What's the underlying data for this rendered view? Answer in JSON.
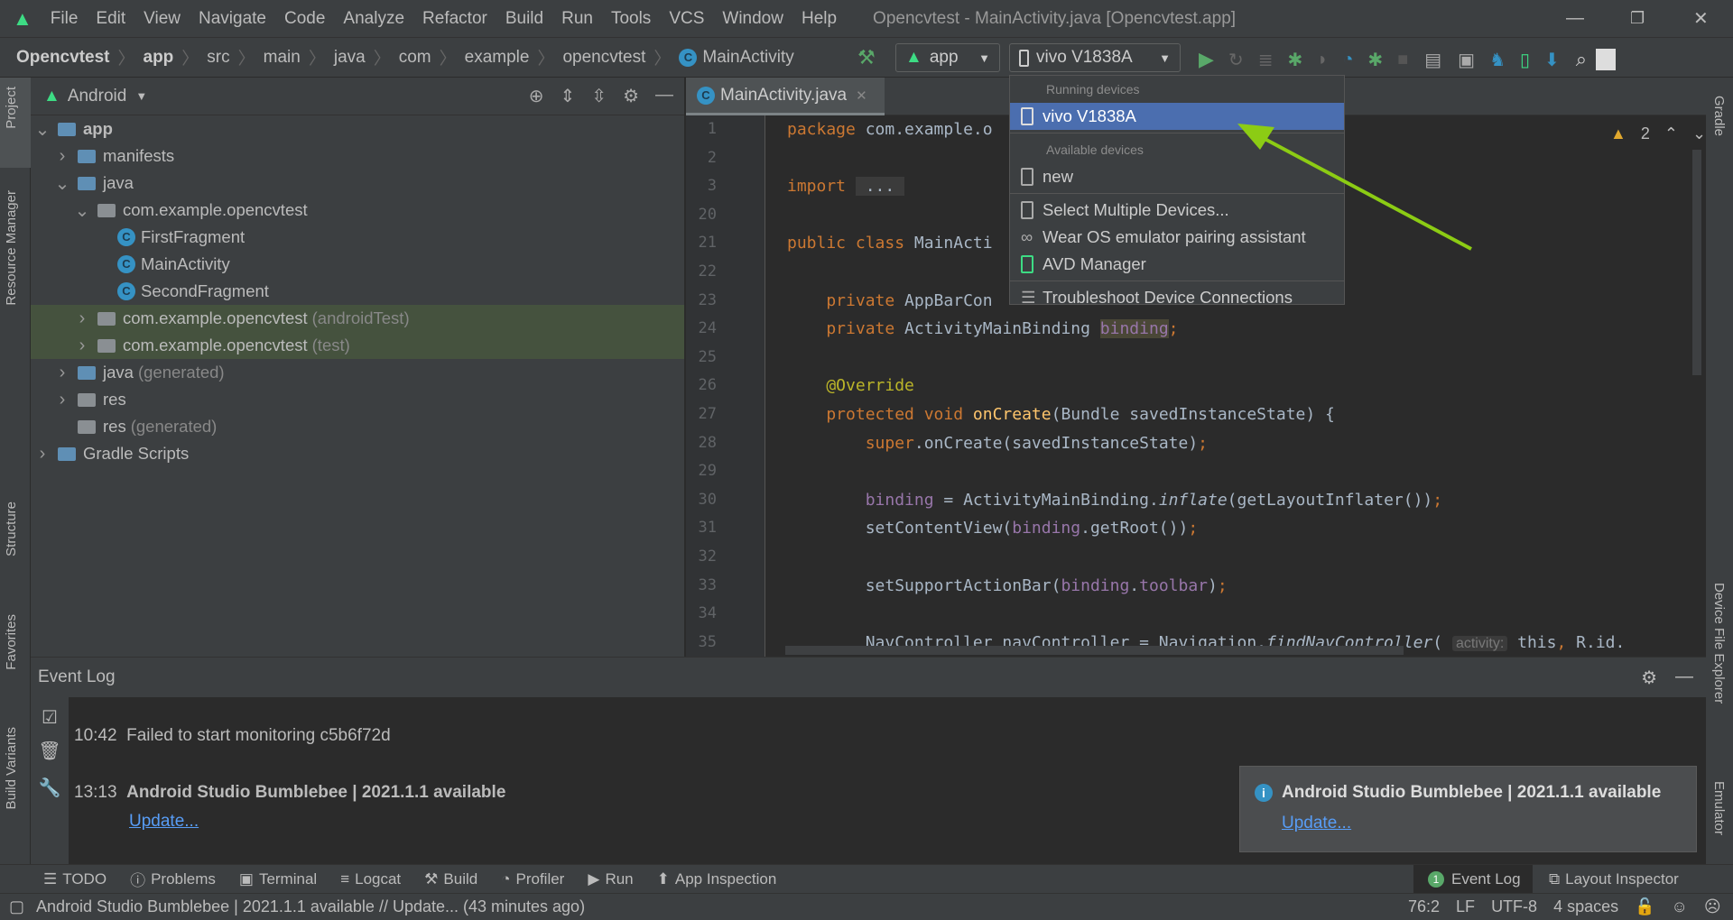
{
  "menu": {
    "items": [
      "File",
      "Edit",
      "View",
      "Navigate",
      "Code",
      "Analyze",
      "Refactor",
      "Build",
      "Run",
      "Tools",
      "VCS",
      "Window",
      "Help"
    ],
    "title": "Opencvtest - MainActivity.java [Opencvtest.app]"
  },
  "breadcrumb": [
    "Opencvtest",
    "app",
    "src",
    "main",
    "java",
    "com",
    "example",
    "opencvtest",
    "MainActivity"
  ],
  "toolbar": {
    "config": "app",
    "device": "vivo V1838A"
  },
  "left_strip": [
    "Project",
    "Resource Manager",
    "Structure",
    "Favorites",
    "Build Variants"
  ],
  "right_strip": [
    "Gradle",
    "Device File Explorer",
    "Emulator"
  ],
  "project": {
    "view": "Android",
    "tree": [
      {
        "label": "app",
        "depth": 0,
        "arrow": "down",
        "bold": true
      },
      {
        "label": "manifests",
        "depth": 1,
        "arrow": "right"
      },
      {
        "label": "java",
        "depth": 1,
        "arrow": "down"
      },
      {
        "label": "com.example.opencvtest",
        "depth": 2,
        "arrow": "down"
      },
      {
        "label": "FirstFragment",
        "depth": 3,
        "class": true
      },
      {
        "label": "MainActivity",
        "depth": 3,
        "class": true
      },
      {
        "label": "SecondFragment",
        "depth": 3,
        "class": true
      },
      {
        "label": "com.example.opencvtest",
        "suffix": "(androidTest)",
        "depth": 2,
        "arrow": "right",
        "selected": true
      },
      {
        "label": "com.example.opencvtest",
        "suffix": "(test)",
        "depth": 2,
        "arrow": "right",
        "selected": true
      },
      {
        "label": "java",
        "suffix": "(generated)",
        "depth": 1,
        "arrow": "right"
      },
      {
        "label": "res",
        "depth": 1,
        "arrow": "right"
      },
      {
        "label": "res",
        "suffix": "(generated)",
        "depth": 1
      },
      {
        "label": "Gradle Scripts",
        "depth": 0,
        "arrow": "right"
      }
    ]
  },
  "editor": {
    "tab": "MainActivity.java",
    "warnings": "2",
    "lines": [
      {
        "n": "1",
        "t": [
          [
            "package ",
            "kw"
          ],
          [
            "com.example.o",
            ""
          ]
        ]
      },
      {
        "n": "2",
        "t": []
      },
      {
        "n": "3",
        "t": [
          [
            "import ",
            "kw"
          ],
          [
            " ... ",
            "fold"
          ]
        ]
      },
      {
        "n": "20",
        "t": []
      },
      {
        "n": "21",
        "t": [
          [
            "public class ",
            "kw"
          ],
          [
            "MainActi",
            ""
          ]
        ]
      },
      {
        "n": "22",
        "t": []
      },
      {
        "n": "23",
        "t": [
          [
            "    private ",
            "kw"
          ],
          [
            "AppBarCon",
            ""
          ]
        ]
      },
      {
        "n": "24",
        "t": [
          [
            "    private ",
            "kw"
          ],
          [
            "ActivityMainBinding ",
            ""
          ],
          [
            "binding",
            "fd hl"
          ],
          [
            ";",
            "kw"
          ]
        ]
      },
      {
        "n": "25",
        "t": []
      },
      {
        "n": "26",
        "t": [
          [
            "    @Override",
            "an"
          ]
        ]
      },
      {
        "n": "27",
        "t": [
          [
            "    protected void ",
            "kw"
          ],
          [
            "onCreate",
            "fn"
          ],
          [
            "(Bundle savedInstanceState) {",
            ""
          ]
        ]
      },
      {
        "n": "28",
        "t": [
          [
            "        super",
            "kw"
          ],
          [
            ".onCreate(savedInstanceState)",
            ""
          ],
          [
            ";",
            "kw"
          ]
        ]
      },
      {
        "n": "29",
        "t": []
      },
      {
        "n": "30",
        "t": [
          [
            "        binding",
            "fd"
          ],
          [
            " = ActivityMainBinding.",
            ""
          ],
          [
            "inflate",
            "it"
          ],
          [
            "(getLayoutInflater())",
            ""
          ],
          [
            ";",
            "kw"
          ]
        ]
      },
      {
        "n": "31",
        "t": [
          [
            "        setContentView(",
            ""
          ],
          [
            "binding",
            "fd"
          ],
          [
            ".getRoot())",
            ""
          ],
          [
            ";",
            "kw"
          ]
        ]
      },
      {
        "n": "32",
        "t": []
      },
      {
        "n": "33",
        "t": [
          [
            "        setSupportActionBar(",
            ""
          ],
          [
            "binding",
            "fd"
          ],
          [
            ".",
            ""
          ],
          [
            "toolbar",
            "fd"
          ],
          [
            ")",
            ""
          ],
          [
            ";",
            "kw"
          ]
        ]
      },
      {
        "n": "34",
        "t": []
      },
      {
        "n": "35",
        "t": [
          [
            "        NavController navController = Navigation.",
            ""
          ],
          [
            "findNavController",
            "it"
          ],
          [
            "( ",
            ""
          ],
          [
            "activity:",
            "hint"
          ],
          [
            " this",
            ""
          ],
          [
            ", ",
            "kw"
          ],
          [
            "R.id.",
            ""
          ]
        ]
      }
    ]
  },
  "dropdown": {
    "running_header": "Running devices",
    "running": [
      "vivo V1838A"
    ],
    "available_header": "Available devices",
    "available": [
      "new"
    ],
    "actions": [
      "Select Multiple Devices...",
      "Wear OS emulator pairing assistant",
      "AVD Manager"
    ],
    "troubleshoot": "Troubleshoot Device Connections"
  },
  "event_log": {
    "title": "Event Log",
    "entries": [
      {
        "time": "10:42",
        "text": "Failed to start monitoring c5b6f72d"
      },
      {
        "time": "13:13",
        "text": "Android Studio Bumblebee | 2021.1.1 available",
        "link": "Update..."
      }
    ]
  },
  "notification": {
    "title": "Android Studio Bumblebee | 2021.1.1 available",
    "link": "Update..."
  },
  "bottom_tools": [
    "TODO",
    "Problems",
    "Terminal",
    "Logcat",
    "Build",
    "Profiler",
    "Run",
    "App Inspection"
  ],
  "bottom_right": {
    "event_log": "Event Log",
    "event_badge": "1",
    "layout_inspector": "Layout Inspector"
  },
  "status": {
    "message": "Android Studio Bumblebee | 2021.1.1 available // Update... (43 minutes ago)",
    "position": "76:2",
    "line_sep": "LF",
    "encoding": "UTF-8",
    "indent": "4 spaces"
  },
  "colors": {
    "accent": "#4b6eaf",
    "arrow": "#8ccc14",
    "android_green": "#3ddc84"
  }
}
